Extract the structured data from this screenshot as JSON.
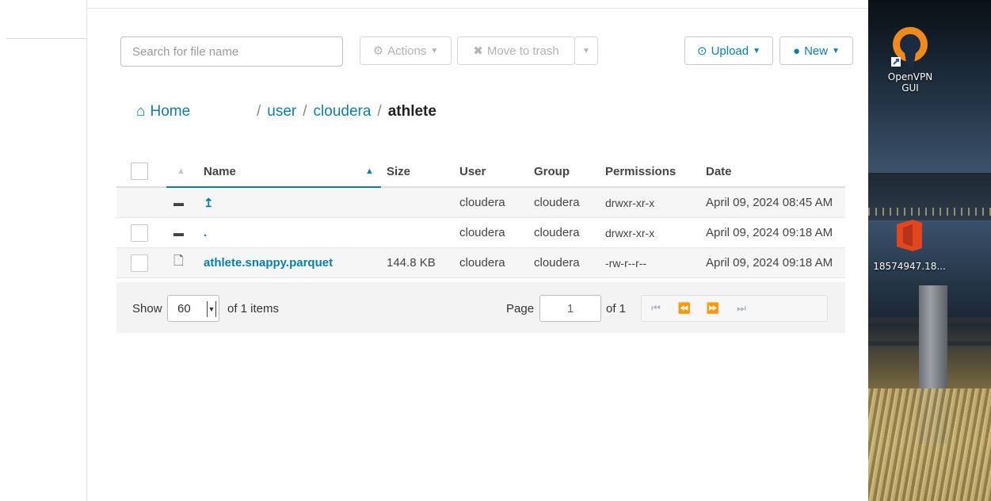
{
  "toolbar": {
    "search_placeholder": "Search for file name",
    "actions_label": "Actions",
    "trash_label": "Move to trash",
    "upload_label": "Upload",
    "new_label": "New"
  },
  "breadcrumb": {
    "home": "Home",
    "segments": [
      "user",
      "cloudera",
      "athlete"
    ]
  },
  "table": {
    "columns": [
      "Name",
      "Size",
      "User",
      "Group",
      "Permissions",
      "Date"
    ],
    "rows": [
      {
        "icon": "folder-icon",
        "name": "↥",
        "size": "",
        "user": "cloudera",
        "group": "cloudera",
        "permissions": "drwxr-xr-x",
        "date": "April 09, 2024 08:45 AM"
      },
      {
        "icon": "folder-icon",
        "name": ".",
        "size": "",
        "user": "cloudera",
        "group": "cloudera",
        "permissions": "drwxr-xr-x",
        "date": "April 09, 2024 09:18 AM"
      },
      {
        "icon": "file-icon",
        "name": "athlete.snappy.parquet",
        "size": "144.8 KB",
        "user": "cloudera",
        "group": "cloudera",
        "permissions": "-rw-r--r--",
        "date": "April 09, 2024 09:18 AM"
      }
    ]
  },
  "footer": {
    "show_label": "Show",
    "page_size": "60",
    "items_label": "of 1 items",
    "page_label": "Page",
    "page_value": "1",
    "of_pages": "of 1"
  },
  "desktop": {
    "openvpn_label": "OpenVPN GUI",
    "office_label": "18574947.18..."
  },
  "colors": {
    "accent": "#0b7fab"
  }
}
